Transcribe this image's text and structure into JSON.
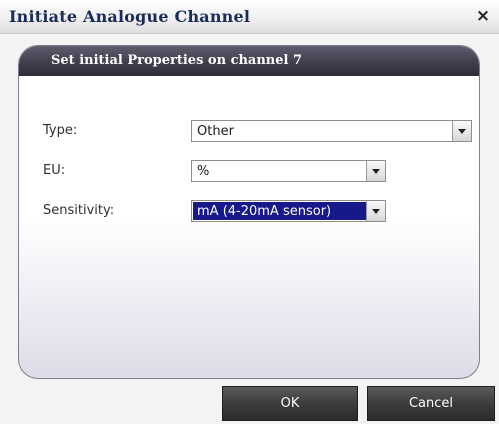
{
  "window": {
    "title": "Initiate Analogue Channel",
    "close_glyph": "×"
  },
  "panel": {
    "header": "Set initial Properties on channel 7"
  },
  "fields": {
    "type": {
      "label": "Type:",
      "value": "Other"
    },
    "eu": {
      "label": "EU:",
      "value": "%"
    },
    "sensitivity": {
      "label": "Sensitivity:",
      "value": "mA (4-20mA sensor)"
    }
  },
  "buttons": {
    "ok": "OK",
    "cancel": "Cancel"
  },
  "colors": {
    "title_text": "#1b2c5a",
    "panel_header": "#3f3f4d",
    "selection_highlight": "#17198a",
    "button_bg": "#3c3c3c"
  },
  "icons": {
    "close": "close-icon",
    "dropdown": "chevron-down-icon"
  }
}
